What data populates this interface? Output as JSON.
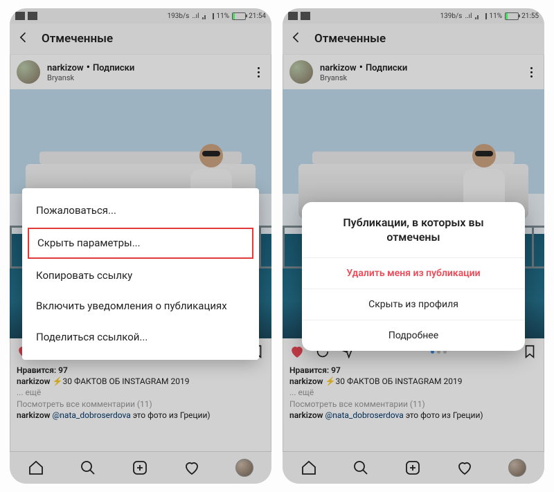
{
  "left": {
    "status": {
      "rate": "193b/s",
      "signal": "..ıl",
      "battery_pct": "11%",
      "time": "21:54"
    },
    "header_title": "Отмеченные",
    "post": {
      "username": "narkizow",
      "subscribe": "Подписки",
      "location": "Bryansk"
    },
    "menu": {
      "report": "Пожаловаться...",
      "hide_params": "Скрыть параметры...",
      "copy_link": "Копировать ссылку",
      "enable_notifs": "Включить уведомления о публикациях",
      "share_link": "Поделиться ссылкой..."
    },
    "likes_label": "Нравится:",
    "likes_count": "97",
    "caption_user": "narkizow",
    "caption_text": "⚡30 ФАКТОВ ОБ INSTAGRAM 2019",
    "more": "... ещё",
    "viewall_prefix": "Посмотреть все комментарии (",
    "viewall_count": "11",
    "viewall_suffix": ")",
    "comment_user": "narkizow",
    "comment_mention": "@nata_dobroserdova",
    "comment_rest": "это фото из Греции)"
  },
  "right": {
    "status": {
      "rate": "139b/s",
      "signal": "..ıl",
      "battery_pct": "11%",
      "time": "21:55"
    },
    "header_title": "Отмеченные",
    "post": {
      "username": "narkizow",
      "subscribe": "Подписки",
      "location": "Bryansk"
    },
    "dialog": {
      "title": "Публикации, в которых вы отмечены",
      "remove": "Удалить меня из публикации",
      "hide": "Скрыть из профиля",
      "more": "Подробнее"
    },
    "likes_label": "Нравится:",
    "likes_count": "97",
    "caption_user": "narkizow",
    "caption_text": "⚡30 ФАКТОВ ОБ INSTAGRAM 2019",
    "more": "... ещё",
    "viewall_prefix": "Посмотреть все комментарии (",
    "viewall_count": "11",
    "viewall_suffix": ")",
    "comment_user": "narkizow",
    "comment_mention": "@nata_dobroserdova",
    "comment_rest": "это фото из Греции)"
  },
  "sep": " • "
}
